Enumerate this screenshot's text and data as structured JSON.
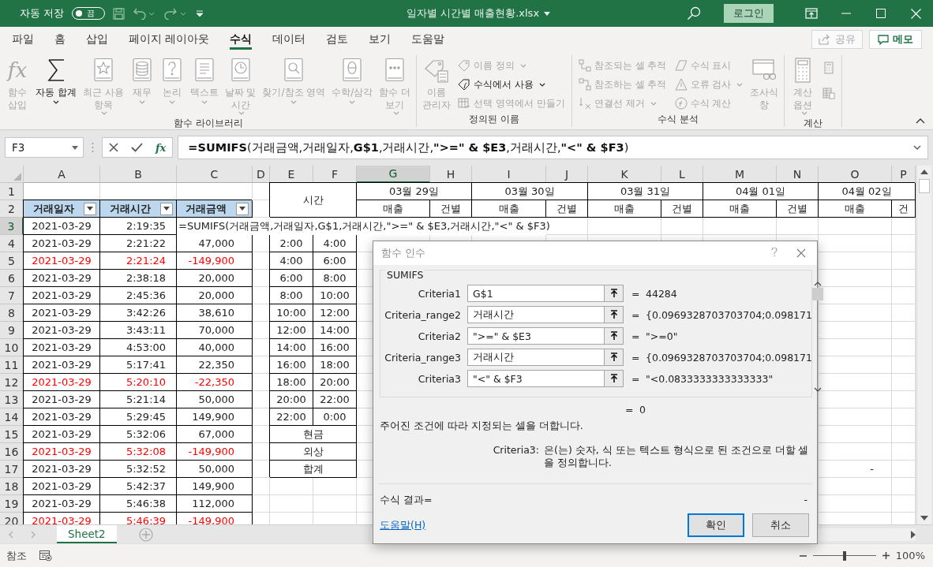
{
  "title_bar": {
    "autosave_label": "자동 저장",
    "autosave": {
      "on": false,
      "label": "끔"
    },
    "title": "일자별 시간별 매출현황.xlsx",
    "login": "로그인"
  },
  "tabs": [
    {
      "label": "파일",
      "selected": false
    },
    {
      "label": "홈",
      "selected": false
    },
    {
      "label": "삽입",
      "selected": false
    },
    {
      "label": "페이지 레이아웃",
      "selected": false
    },
    {
      "label": "수식",
      "selected": true
    },
    {
      "label": "데이터",
      "selected": false
    },
    {
      "label": "검토",
      "selected": false
    },
    {
      "label": "보기",
      "selected": false
    },
    {
      "label": "도움말",
      "selected": false
    }
  ],
  "share": {
    "label": "공유",
    "disabled": true
  },
  "comments": {
    "label": "메모"
  },
  "ribbon": {
    "groups": [
      {
        "label": "함수 라이브러리",
        "items": [
          {
            "kind": "large",
            "glyph": "fx",
            "label": "함수\n삽입",
            "disabled": true,
            "menu": false
          },
          {
            "kind": "large",
            "label": "자동 합계",
            "disabled": false,
            "menu": true
          },
          {
            "kind": "large",
            "label": "최근 사용\n항목",
            "disabled": true,
            "menu": true
          },
          {
            "kind": "large",
            "label": "재무",
            "disabled": true,
            "menu": true
          },
          {
            "kind": "large",
            "label": "논리",
            "disabled": true,
            "menu": true
          },
          {
            "kind": "large",
            "label": "텍스트",
            "disabled": true,
            "menu": true
          },
          {
            "kind": "large",
            "label": "날짜 및\n시간",
            "disabled": true,
            "menu": true
          },
          {
            "kind": "large",
            "label": "찾기/참조 영역",
            "disabled": true,
            "menu": true
          },
          {
            "kind": "large",
            "label": "수학/삼각",
            "disabled": true,
            "menu": true
          },
          {
            "kind": "large",
            "label": "함수 더\n보기",
            "disabled": true,
            "menu": true
          }
        ]
      },
      {
        "label": "정의된 이름",
        "items": [
          {
            "kind": "large",
            "label": "이름\n관리자",
            "disabled": true,
            "menu": false
          },
          {
            "kind": "small",
            "label": "이름 정의",
            "disabled": true,
            "menu": true
          },
          {
            "kind": "small",
            "label": "수식에서 사용",
            "disabled": false,
            "menu": true
          },
          {
            "kind": "small",
            "label": "선택 영역에서 만들기",
            "disabled": true,
            "menu": false
          }
        ]
      },
      {
        "label": "수식 분석",
        "items": [
          {
            "kind": "small",
            "label": "참조되는 셀 추적",
            "disabled": true,
            "menu": false
          },
          {
            "kind": "small",
            "label": "참조하는 셀 추적",
            "disabled": true,
            "menu": false
          },
          {
            "kind": "small",
            "label": "연결선 제거",
            "disabled": true,
            "menu": true
          },
          {
            "kind": "small",
            "label": "수식 표시",
            "disabled": true,
            "menu": false
          },
          {
            "kind": "small",
            "label": "오류 검사",
            "disabled": true,
            "menu": true
          },
          {
            "kind": "small",
            "label": "수식 계산",
            "disabled": true,
            "menu": false
          },
          {
            "kind": "large",
            "label": "조사식\n창",
            "disabled": true,
            "menu": false
          }
        ]
      },
      {
        "label": "계산",
        "items": [
          {
            "kind": "large",
            "label": "계산\n옵션",
            "disabled": true,
            "menu": true
          },
          {
            "kind": "icon",
            "disabled": true
          },
          {
            "kind": "icon",
            "disabled": true
          }
        ]
      }
    ]
  },
  "formula_bar": {
    "name_box": "F3",
    "fx": "fx",
    "formula": "**=SUMIFS**(거래금액,거래일자,**G$1**,거래시간,**\">=\" & $E3**,거래시간,**\"<\" & $F3**)"
  },
  "sheet": {
    "column_headers": [
      {
        "label": "A",
        "selected": false
      },
      {
        "label": "B",
        "selected": false
      },
      {
        "label": "C",
        "selected": false
      },
      {
        "label": "D",
        "selected": false
      },
      {
        "label": "E",
        "selected": false
      },
      {
        "label": "F",
        "selected": false
      },
      {
        "label": "G",
        "selected": true
      },
      {
        "label": "H",
        "selected": false
      },
      {
        "label": "I",
        "selected": false
      },
      {
        "label": "J",
        "selected": false
      },
      {
        "label": "K",
        "selected": false
      },
      {
        "label": "L",
        "selected": false
      },
      {
        "label": "M",
        "selected": false
      },
      {
        "label": "N",
        "selected": false
      },
      {
        "label": "O",
        "selected": false
      },
      {
        "label": "P",
        "selected": false
      }
    ],
    "rows": [
      {
        "kind": "dates",
        "number": "1",
        "selected": false,
        "time_header": "시간",
        "dates": [
          "03월 29일",
          "03월 30일",
          "03월 31일",
          "04월 01일",
          "04월 02일"
        ]
      },
      {
        "kind": "headers",
        "number": "2",
        "selected": false,
        "columns": [
          "거래일자",
          "거래시간",
          "거래금액"
        ],
        "sub_headers": [
          "매출",
          "건별",
          "매출",
          "건별",
          "매출",
          "건별",
          "매출",
          "건별",
          "매출",
          "건"
        ]
      },
      {
        "kind": "entry",
        "number": "3",
        "selected": true,
        "date": "2021-03-29",
        "time": "2:19:35",
        "formula": "=SUMIFS(거래금액,거래일자,G$1,거래시간,\">=\" & $E3,거래시간,\"<\" & $F3)"
      },
      {
        "kind": "data",
        "number": "4",
        "selected": false,
        "date": "2021-03-29",
        "time": "2:21:22",
        "amount": "47,000",
        "negative": false,
        "slot": [
          "2:00",
          "4:00"
        ]
      },
      {
        "kind": "data",
        "number": "5",
        "selected": false,
        "date": "2021-03-29",
        "time": "2:21:24",
        "amount": "-149,900",
        "negative": true,
        "slot": [
          "4:00",
          "6:00"
        ]
      },
      {
        "kind": "data",
        "number": "6",
        "selected": false,
        "date": "2021-03-29",
        "time": "2:38:18",
        "amount": "20,000",
        "negative": false,
        "slot": [
          "6:00",
          "8:00"
        ]
      },
      {
        "kind": "data",
        "number": "7",
        "selected": false,
        "date": "2021-03-29",
        "time": "2:45:36",
        "amount": "20,000",
        "negative": false,
        "slot": [
          "8:00",
          "10:00"
        ]
      },
      {
        "kind": "data",
        "number": "8",
        "selected": false,
        "date": "2021-03-29",
        "time": "3:42:26",
        "amount": "38,610",
        "negative": false,
        "slot": [
          "10:00",
          "12:00"
        ]
      },
      {
        "kind": "data",
        "number": "9",
        "selected": false,
        "date": "2021-03-29",
        "time": "3:43:11",
        "amount": "70,000",
        "negative": false,
        "slot": [
          "12:00",
          "14:00"
        ]
      },
      {
        "kind": "data",
        "number": "10",
        "selected": false,
        "date": "2021-03-29",
        "time": "4:53:00",
        "amount": "40,000",
        "negative": false,
        "slot": [
          "14:00",
          "16:00"
        ]
      },
      {
        "kind": "data",
        "number": "11",
        "selected": false,
        "date": "2021-03-29",
        "time": "5:17:41",
        "amount": "22,350",
        "negative": false,
        "slot": [
          "16:00",
          "18:00"
        ]
      },
      {
        "kind": "data",
        "number": "12",
        "selected": false,
        "date": "2021-03-29",
        "time": "5:20:10",
        "amount": "-22,350",
        "negative": true,
        "slot": [
          "18:00",
          "20:00"
        ]
      },
      {
        "kind": "data",
        "number": "13",
        "selected": false,
        "date": "2021-03-29",
        "time": "5:21:14",
        "amount": "50,000",
        "negative": false,
        "slot": [
          "20:00",
          "22:00"
        ]
      },
      {
        "kind": "data",
        "number": "14",
        "selected": false,
        "date": "2021-03-29",
        "time": "5:29:45",
        "amount": "149,900",
        "negative": false,
        "slot": [
          "22:00",
          "0:00"
        ]
      },
      {
        "kind": "data",
        "number": "15",
        "selected": false,
        "date": "2021-03-29",
        "time": "5:32:06",
        "amount": "67,000",
        "negative": false,
        "label": "현금"
      },
      {
        "kind": "data",
        "number": "16",
        "selected": false,
        "date": "2021-03-29",
        "time": "5:32:08",
        "amount": "-149,900",
        "negative": true,
        "label": "외상"
      },
      {
        "kind": "data",
        "number": "17",
        "selected": false,
        "date": "2021-03-29",
        "time": "5:32:52",
        "amount": "50,000",
        "negative": false,
        "label": "합계",
        "column_o": "-"
      },
      {
        "kind": "data",
        "number": "18",
        "selected": false,
        "date": "2021-03-29",
        "time": "5:42:37",
        "amount": "149,900",
        "negative": false
      },
      {
        "kind": "data",
        "number": "19",
        "selected": false,
        "date": "2021-03-29",
        "time": "5:46:38",
        "amount": "112,000",
        "negative": false
      },
      {
        "kind": "data",
        "number": "20",
        "selected": false,
        "date": "2021-03-29",
        "time": "5:46:39",
        "amount": "-149,900",
        "negative": true
      }
    ]
  },
  "sheet_tabs": [
    {
      "label": "Sheet2",
      "selected": true
    }
  ],
  "dialog": {
    "title": "함수 인수",
    "function": "SUMIFS",
    "arguments": [
      {
        "name": "Criteria1",
        "value": "G$1",
        "equals": "=",
        "result": "44284"
      },
      {
        "name": "Criteria_range2",
        "value": "거래시간",
        "equals": "=",
        "result": "{0.0969328703703704;0.098171"
      },
      {
        "name": "Criteria2",
        "value": "\">=\" & $E3",
        "equals": "=",
        "result": "\">=0\""
      },
      {
        "name": "Criteria_range3",
        "value": "거래시간",
        "equals": "=",
        "result": "{0.0969328703703704;0.098171"
      },
      {
        "name": "Criteria3",
        "value": "\"<\" & $F3",
        "equals": "=",
        "result": "\"<0.0833333333333333\""
      }
    ],
    "total": {
      "equals": "=",
      "value": "0"
    },
    "description": "주어진 조건에 따라 지정되는 셀을 더합니다.",
    "arg_help": {
      "name": "Criteria3:",
      "text": "은(는) 숫자, 식 또는 텍스트 형식으로 된 조건으로 더할 셀을 정의합니다."
    },
    "formula_result": {
      "label": "수식 결과=",
      "value": "-"
    },
    "help_link": "도움말(H)",
    "buttons": [
      {
        "label": "확인",
        "default": true
      },
      {
        "label": "취소",
        "default": false
      }
    ]
  },
  "status_bar": {
    "mode": "참조",
    "zoom": {
      "level": 0.5,
      "reading": "100%"
    }
  }
}
